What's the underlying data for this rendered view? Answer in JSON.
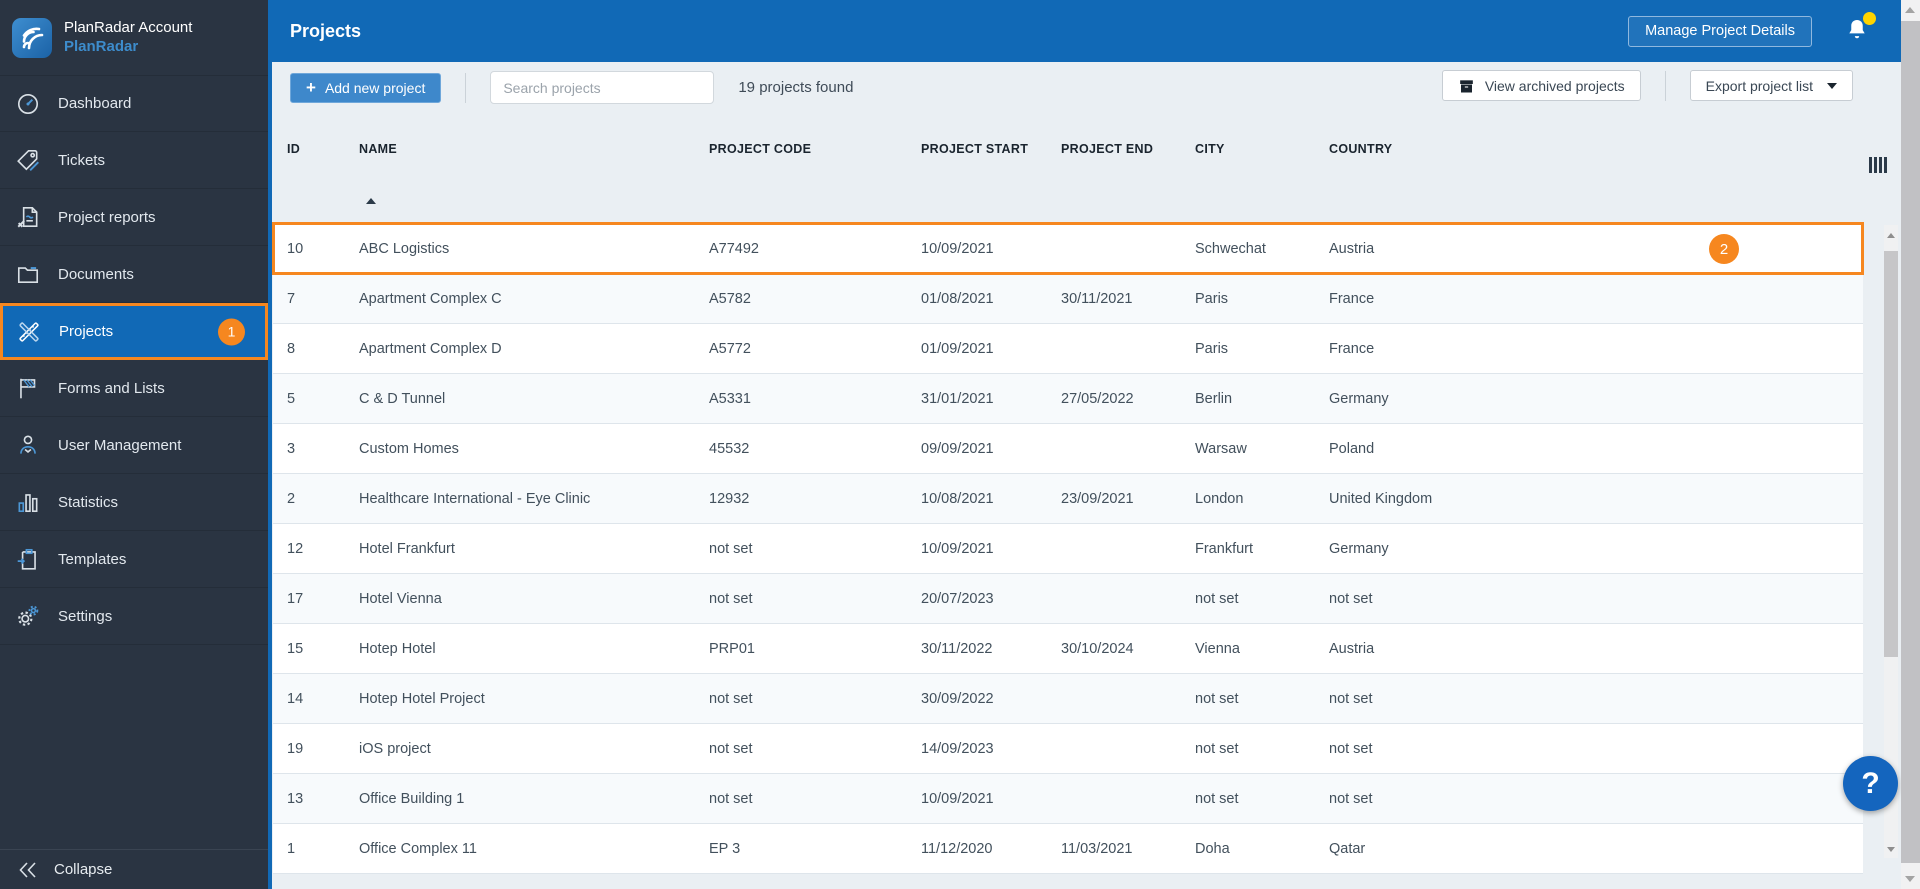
{
  "sidebar": {
    "account_title": "PlanRadar Account",
    "account_subtitle": "PlanRadar",
    "items": [
      {
        "label": "Dashboard",
        "icon": "gauge-icon"
      },
      {
        "label": "Tickets",
        "icon": "tag-icon"
      },
      {
        "label": "Project reports",
        "icon": "report-icon"
      },
      {
        "label": "Documents",
        "icon": "folder-icon"
      },
      {
        "label": "Projects",
        "icon": "ruler-pencil-icon",
        "active": true,
        "badge": "1"
      },
      {
        "label": "Forms and Lists",
        "icon": "flag-icon"
      },
      {
        "label": "User Management",
        "icon": "user-icon"
      },
      {
        "label": "Statistics",
        "icon": "bar-chart-icon"
      },
      {
        "label": "Templates",
        "icon": "clipboard-icon"
      },
      {
        "label": "Settings",
        "icon": "gears-icon"
      }
    ],
    "collapse_label": "Collapse"
  },
  "header": {
    "title": "Projects",
    "manage_button_label": "Manage Project Details",
    "notification_icon": "bell-icon",
    "notification_dot": true
  },
  "toolbar": {
    "add_button_label": "Add new project",
    "add_button_plus": "+",
    "search_placeholder": "Search projects",
    "results_text": "19 projects found",
    "archived_button_label": "View archived projects",
    "archived_button_icon": "archive-box-icon",
    "export_button_label": "Export project list",
    "export_button_icon": "chevron-down-icon"
  },
  "table": {
    "columns": [
      "ID",
      "NAME",
      "PROJECT CODE",
      "PROJECT START",
      "PROJECT END",
      "CITY",
      "COUNTRY"
    ],
    "sorted_column": "NAME",
    "sort_direction": "ascending",
    "rows": [
      {
        "id": "10",
        "name": "ABC Logistics",
        "code": "A77492",
        "start": "10/09/2021",
        "end": "",
        "city": "Schwechat",
        "country": "Austria",
        "highlighted": true,
        "badge": "2"
      },
      {
        "id": "7",
        "name": "Apartment Complex C",
        "code": "A5782",
        "start": "01/08/2021",
        "end": "30/11/2021",
        "city": "Paris",
        "country": "France"
      },
      {
        "id": "8",
        "name": "Apartment Complex D",
        "code": "A5772",
        "start": "01/09/2021",
        "end": "",
        "city": "Paris",
        "country": "France"
      },
      {
        "id": "5",
        "name": "C & D Tunnel",
        "code": "A5331",
        "start": "31/01/2021",
        "end": "27/05/2022",
        "city": "Berlin",
        "country": "Germany"
      },
      {
        "id": "3",
        "name": "Custom Homes",
        "code": "45532",
        "start": "09/09/2021",
        "end": "",
        "city": "Warsaw",
        "country": "Poland"
      },
      {
        "id": "2",
        "name": "Healthcare International - Eye Clinic",
        "code": "12932",
        "start": "10/08/2021",
        "end": "23/09/2021",
        "city": "London",
        "country": "United Kingdom"
      },
      {
        "id": "12",
        "name": "Hotel Frankfurt",
        "code": "not set",
        "start": "10/09/2021",
        "end": "",
        "city": "Frankfurt",
        "country": "Germany"
      },
      {
        "id": "17",
        "name": "Hotel Vienna",
        "code": "not set",
        "start": "20/07/2023",
        "end": "",
        "city": "not set",
        "country": "not set"
      },
      {
        "id": "15",
        "name": "Hotep Hotel",
        "code": "PRP01",
        "start": "30/11/2022",
        "end": "30/10/2024",
        "city": "Vienna",
        "country": "Austria"
      },
      {
        "id": "14",
        "name": "Hotep Hotel Project",
        "code": "not set",
        "start": "30/09/2022",
        "end": "",
        "city": "not set",
        "country": "not set"
      },
      {
        "id": "19",
        "name": "iOS project",
        "code": "not set",
        "start": "14/09/2023",
        "end": "",
        "city": "not set",
        "country": "not set"
      },
      {
        "id": "13",
        "name": "Office Building 1",
        "code": "not set",
        "start": "10/09/2021",
        "end": "",
        "city": "not set",
        "country": "not set"
      },
      {
        "id": "1",
        "name": "Office Complex 11",
        "code": "EP 3",
        "start": "11/12/2020",
        "end": "11/03/2021",
        "city": "Doha",
        "country": "Qatar"
      }
    ]
  },
  "help_button": {
    "label": "?"
  },
  "colors": {
    "accent_orange": "#F6871F",
    "header_blue": "#1169B6",
    "sidebar_dark": "#2A3442",
    "brand_blue": "#3D8CCC",
    "notification_yellow": "#FFD400",
    "help_blue": "#1465BE"
  }
}
